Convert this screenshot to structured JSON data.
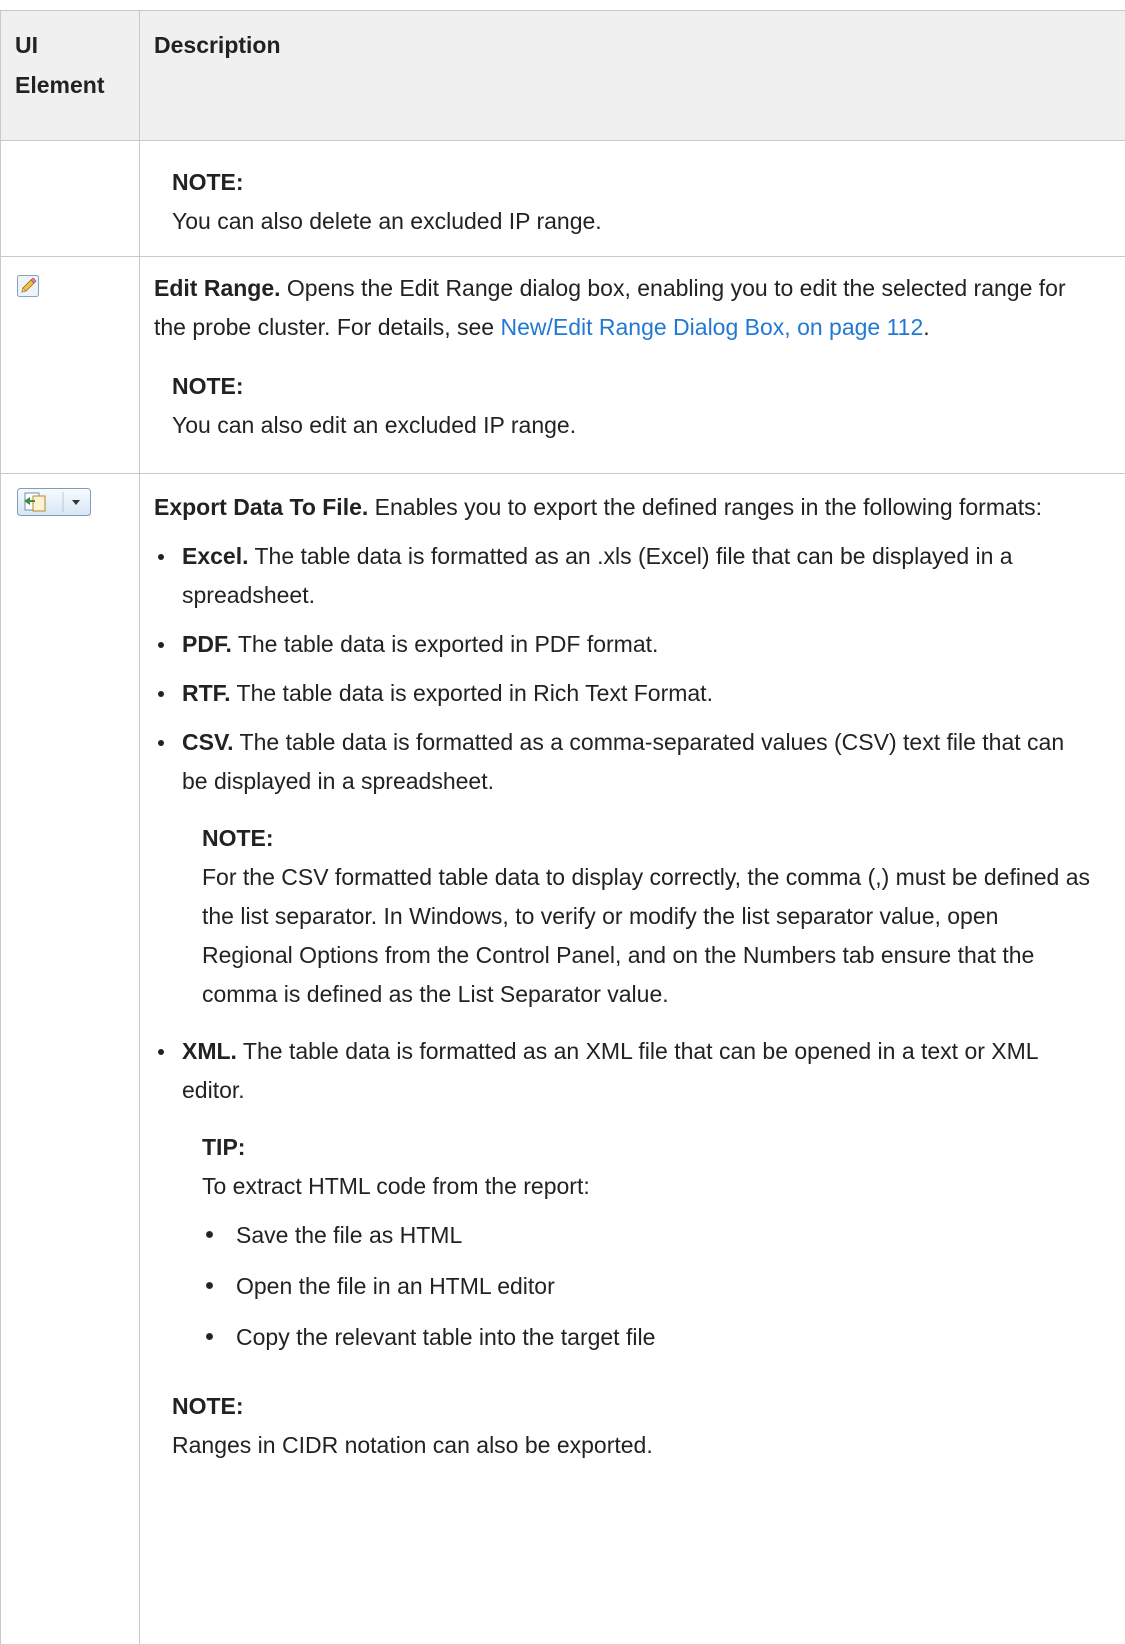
{
  "header": {
    "col1": "UI Element",
    "col2": "Description"
  },
  "row1": {
    "note_label": "NOTE:",
    "note_text": "You can also delete an excluded IP range."
  },
  "row2": {
    "icon": "pencil-edit-icon",
    "title": "Edit Range.",
    "text": " Opens the Edit Range dialog box, enabling you to edit the selected range for the probe cluster. For details, see ",
    "link": "New/Edit Range Dialog Box, on page 112",
    "after_link": ".",
    "note_label": "NOTE:",
    "note_text": "You can also edit an excluded IP range."
  },
  "row3": {
    "icon": "export-data-icon",
    "title": "Export Data To File.",
    "text": " Enables you to export the defined ranges in the following formats:",
    "items": [
      {
        "title": "Excel.",
        "text": " The table data is formatted as an .xls (Excel) file that can be displayed in a spreadsheet."
      },
      {
        "title": "PDF.",
        "text": " The table data is exported in PDF format."
      },
      {
        "title": "RTF.",
        "text": " The table data is exported in Rich Text Format."
      },
      {
        "title": "CSV.",
        "text": " The table data is formatted as a comma-separated values (CSV) text file that can be displayed in a spreadsheet."
      },
      {
        "title": "XML.",
        "text": " The table data is formatted as an XML file that can be opened in a text or XML editor."
      }
    ],
    "csv_note_label": "NOTE:",
    "csv_note_text": "For the CSV formatted table data to display correctly, the comma (,) must be defined as the list separator. In Windows, to verify or modify the list separator value, open Regional Options from the Control Panel, and on the Numbers tab ensure that the comma is defined as the List Separator value.",
    "tip_label": "TIP:",
    "tip_text": "To extract HTML code from the report:",
    "tip_items": [
      "Save the file as HTML",
      "Open the file in an HTML editor",
      "Copy the relevant table into the target file"
    ],
    "note_label": "NOTE:",
    "note_text": "Ranges in CIDR notation can also be exported."
  }
}
